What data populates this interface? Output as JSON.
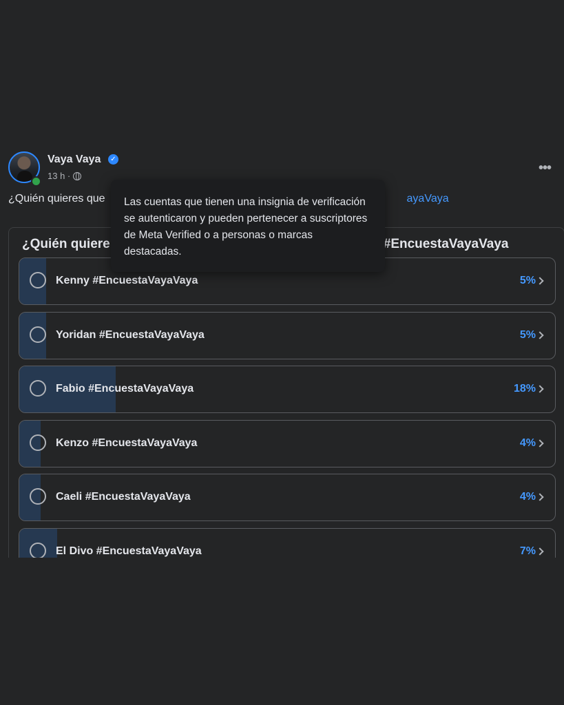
{
  "post": {
    "author": "Vaya Vaya",
    "time": "13 h ·",
    "caption_prefix": "¿Quién quieres que",
    "caption_tag": "ayaVaya",
    "more_label": "•••"
  },
  "poll": {
    "question_prefix": "¿Quién quiere",
    "question_tag": "#EncuestaVayaVaya",
    "options": [
      {
        "label": "Kenny #EncuestaVayaVaya",
        "percent": "5%",
        "value": 5
      },
      {
        "label": "Yoridan #EncuestaVayaVaya",
        "percent": "5%",
        "value": 5
      },
      {
        "label": "Fabio #EncuestaVayaVaya",
        "percent": "18%",
        "value": 18
      },
      {
        "label": "Kenzo #EncuestaVayaVaya",
        "percent": "4%",
        "value": 4
      },
      {
        "label": "Caeli #EncuestaVayaVaya",
        "percent": "4%",
        "value": 4
      },
      {
        "label": "El Divo #EncuestaVayaVaya",
        "percent": "7%",
        "value": 7
      }
    ]
  },
  "tooltip": {
    "text": "Las cuentas que tienen una insignia de verificación se autenticaron y pueden pertenecer a suscriptores de Meta Verified o a personas o marcas destacadas."
  },
  "icons": {
    "verified": "verified-badge-icon",
    "globe": "globe-icon",
    "more": "more-options-icon",
    "chevron": "chevron-right-icon"
  },
  "colors": {
    "background": "#242526",
    "accent": "#4599ff",
    "verified": "#2d88ff",
    "online": "#31a24c",
    "fill": "#263951"
  }
}
